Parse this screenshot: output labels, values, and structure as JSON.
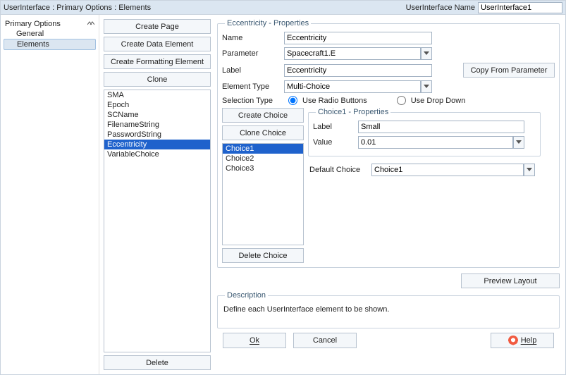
{
  "header": {
    "breadcrumb": "UserInterface : Primary Options : Elements",
    "name_label": "UserInterface Name",
    "name_value": "UserInterface1"
  },
  "tree": {
    "root": "Primary Options",
    "items": [
      "General",
      "Elements"
    ],
    "selected": "Elements"
  },
  "mid_buttons": {
    "create_page": "Create Page",
    "create_data": "Create Data Element",
    "create_fmt": "Create Formatting Element",
    "clone": "Clone",
    "delete": "Delete"
  },
  "elements_list": {
    "items": [
      "SMA",
      "Epoch",
      "SCName",
      "FilenameString",
      "PasswordString",
      "Eccentricity",
      "VariableChoice"
    ],
    "selected": "Eccentricity"
  },
  "props": {
    "legend": "Eccentricity - Properties",
    "name_label": "Name",
    "name_value": "Eccentricity",
    "param_label": "Parameter",
    "param_value": "Spacecraft1.E",
    "label_label": "Label",
    "label_value": "Eccentricity",
    "copy_btn": "Copy From Parameter",
    "eltype_label": "Element Type",
    "eltype_value": "Multi-Choice",
    "seltype_label": "Selection Type",
    "radio1": "Use Radio Buttons",
    "radio2": "Use Drop Down"
  },
  "choice_buttons": {
    "create": "Create Choice",
    "clone": "Clone Choice",
    "delete": "Delete Choice"
  },
  "choices_list": {
    "items": [
      "Choice1",
      "Choice2",
      "Choice3"
    ],
    "selected": "Choice1"
  },
  "choice_props": {
    "legend": "Choice1 - Properties",
    "label_label": "Label",
    "label_value": "Small",
    "value_label": "Value",
    "value_value": "0.01"
  },
  "default_choice": {
    "label": "Default Choice",
    "value": "Choice1"
  },
  "preview_btn": "Preview Layout",
  "description": {
    "legend": "Description",
    "text": "Define each UserInterface element to be shown."
  },
  "footer": {
    "ok": "Ok",
    "cancel": "Cancel",
    "help": "Help"
  }
}
